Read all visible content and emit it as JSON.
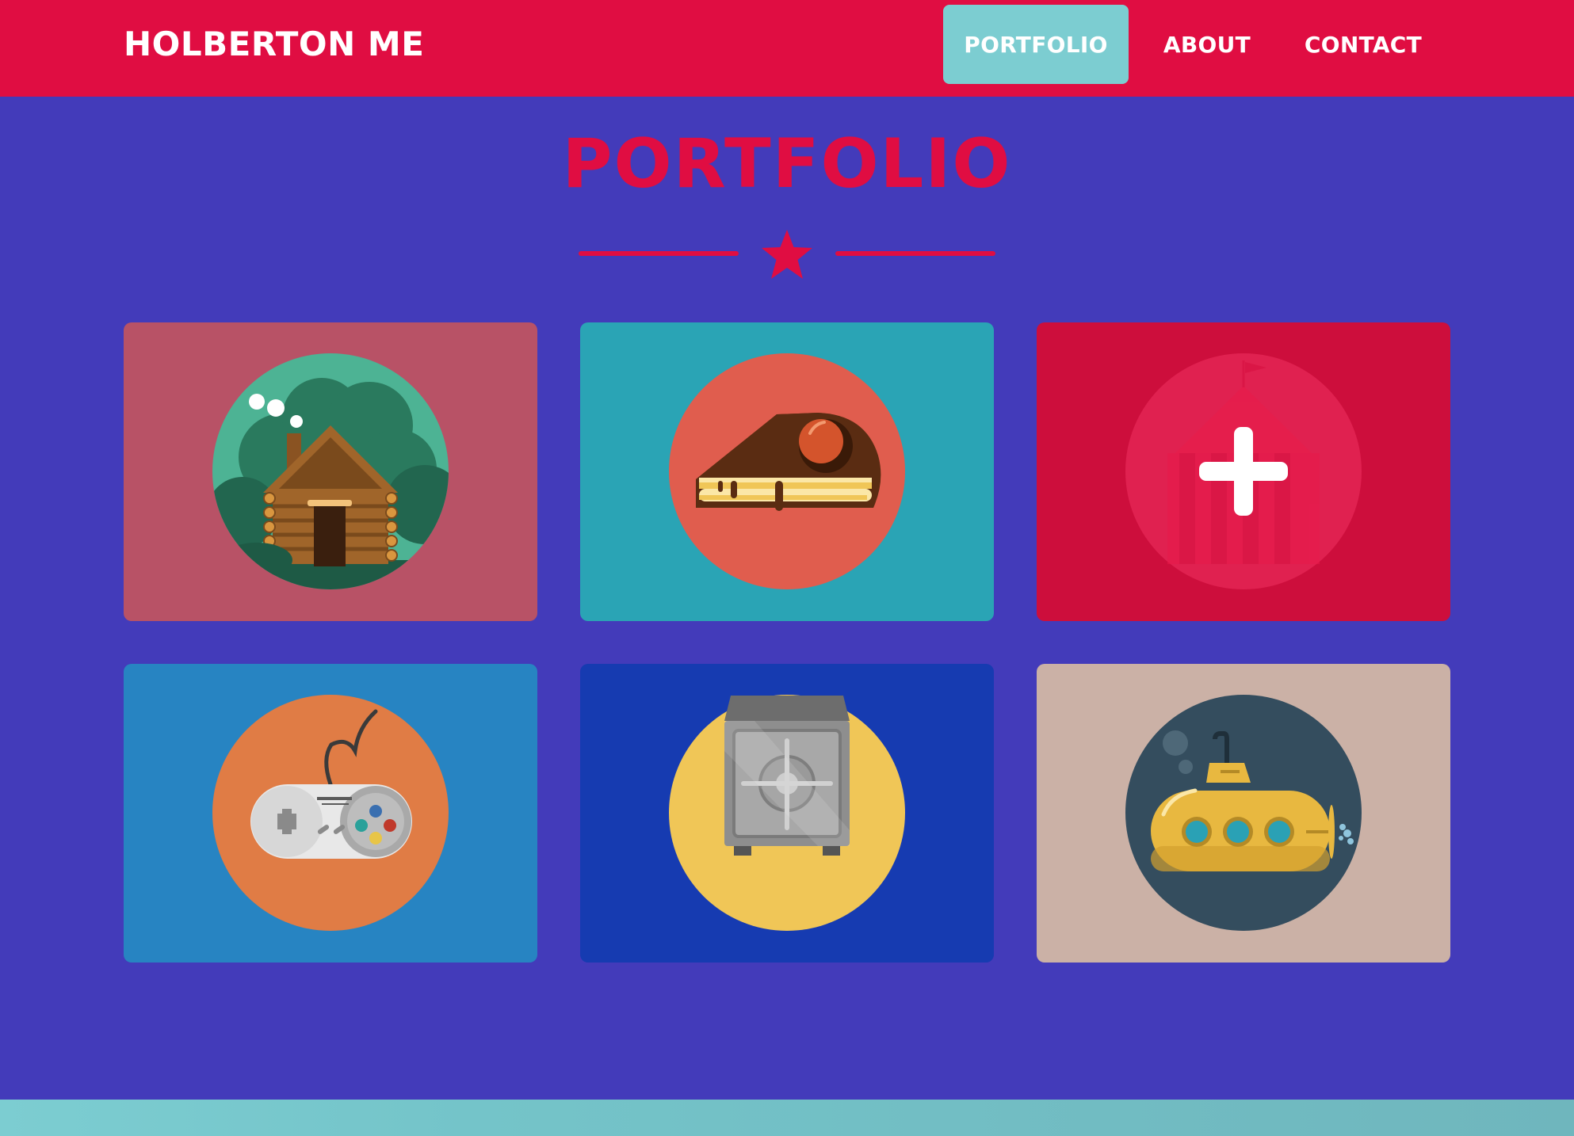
{
  "nav": {
    "brand": "HOLBERTON ME",
    "links": [
      {
        "label": "PORTFOLIO",
        "active": true
      },
      {
        "label": "ABOUT",
        "active": false
      },
      {
        "label": "CONTACT",
        "active": false
      }
    ]
  },
  "portfolio": {
    "title": "PORTFOLIO",
    "divider_icon": "star-icon",
    "items": [
      {
        "icon": "cabin-icon",
        "background": "#b85266",
        "circle": "#4db394"
      },
      {
        "icon": "cake-icon",
        "background": "#2aa4b5",
        "circle": "#e05d4e"
      },
      {
        "icon": "circus-tent-icon",
        "background": "#cd0e3c",
        "circle": "#e02150",
        "hover_icon": "plus-icon"
      },
      {
        "icon": "game-controller-icon",
        "background": "#2784c2",
        "circle": "#e07c45"
      },
      {
        "icon": "safe-icon",
        "background": "#163bb1",
        "circle": "#f0c657"
      },
      {
        "icon": "submarine-icon",
        "background": "#cbb1a6",
        "circle": "#344d5e"
      }
    ]
  },
  "colors": {
    "primary": "#e00d42",
    "page_background": "#433bba",
    "accent": "#7ccdd1"
  }
}
